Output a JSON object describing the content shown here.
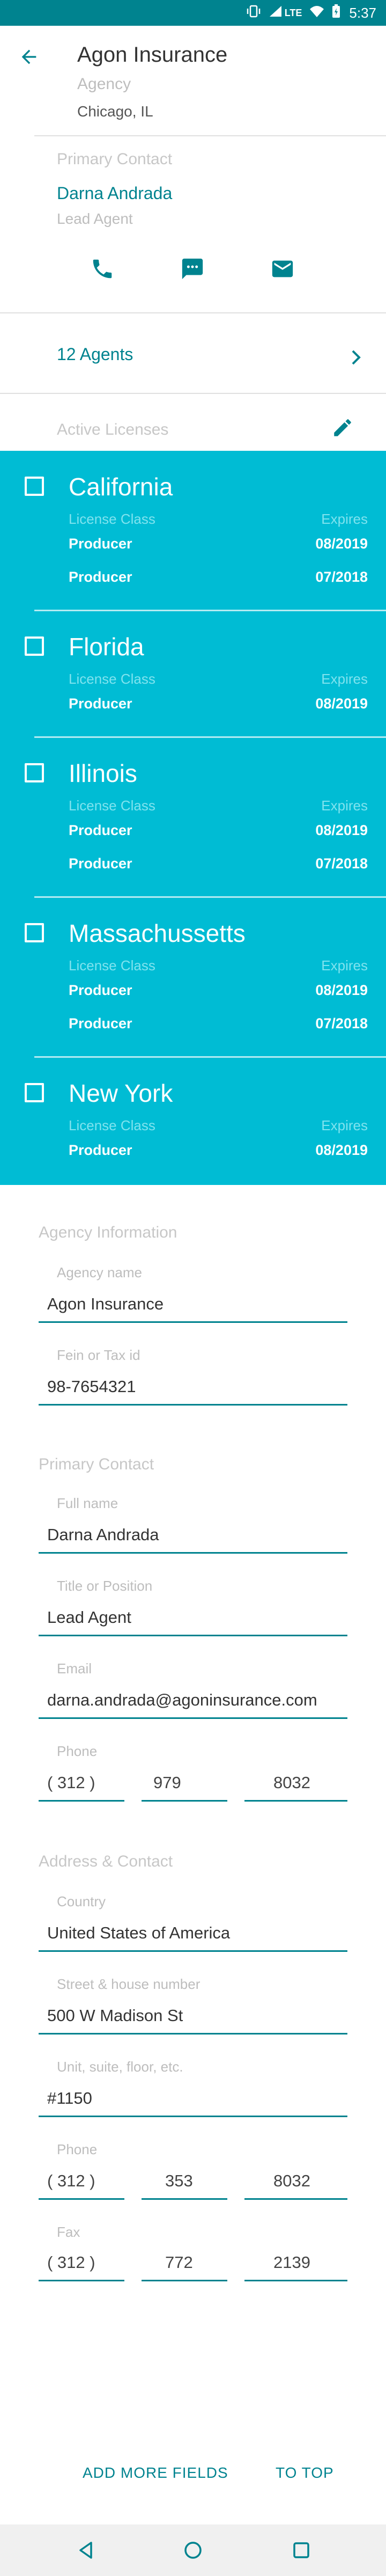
{
  "status": {
    "time": "5:37",
    "network": "LTE"
  },
  "header": {
    "title": "Agon Insurance",
    "subtitle": "Agency",
    "location": "Chicago, IL"
  },
  "primary_contact": {
    "section_label": "Primary Contact",
    "name": "Darna Andrada",
    "title": "Lead Agent",
    "actions": [
      "phone-icon",
      "message-icon",
      "email-icon"
    ]
  },
  "agents": {
    "label": "12 Agents"
  },
  "licenses": {
    "section_label": "Active Licenses",
    "class_label": "License Class",
    "expires_label": "Expires",
    "states": [
      {
        "name": "California",
        "rows": [
          {
            "type": "Producer",
            "date": "08/2019"
          },
          {
            "type": "Producer",
            "date": "07/2018"
          }
        ]
      },
      {
        "name": "Florida",
        "rows": [
          {
            "type": "Producer",
            "date": "08/2019"
          }
        ]
      },
      {
        "name": "Illinois",
        "rows": [
          {
            "type": "Producer",
            "date": "08/2019"
          },
          {
            "type": "Producer",
            "date": "07/2018"
          }
        ]
      },
      {
        "name": "Massachussetts",
        "rows": [
          {
            "type": "Producer",
            "date": "08/2019"
          },
          {
            "type": "Producer",
            "date": "07/2018"
          }
        ]
      },
      {
        "name": "New York",
        "rows": [
          {
            "type": "Producer",
            "date": "08/2019"
          }
        ]
      }
    ]
  },
  "agency_info": {
    "title": "Agency Information",
    "name_label": "Agency name",
    "name_value": "Agon Insurance",
    "fein_label": "Fein or Tax id",
    "fein_value": "98-7654321"
  },
  "contact_form": {
    "title": "Primary Contact",
    "fullname_label": "Full name",
    "fullname_value": "Darna Andrada",
    "position_label": "Title or Position",
    "position_value": "Lead Agent",
    "email_label": "Email",
    "email_value": "darna.andrada@agoninsurance.com",
    "phone_label": "Phone",
    "phone_area": "( 312 )",
    "phone_prefix": "979",
    "phone_line": "8032"
  },
  "address": {
    "title": "Address & Contact",
    "country_label": "Country",
    "country_value": "United States of America",
    "street_label": "Street & house number",
    "street_value": "500 W Madison St",
    "unit_label": "Unit, suite, floor, etc.",
    "unit_value": "#1150",
    "phone_label": "Phone",
    "phone_area": "( 312 )",
    "phone_prefix": "353",
    "phone_line": "8032",
    "fax_label": "Fax",
    "fax_area": "( 312 )",
    "fax_prefix": "772",
    "fax_line": "2139"
  },
  "footer": {
    "add_fields": "ADD MORE FIELDS",
    "to_top": "TO TOP"
  },
  "colors": {
    "accent": "#00838f",
    "panel": "#00bcd4",
    "statusbar": "#00838f"
  }
}
